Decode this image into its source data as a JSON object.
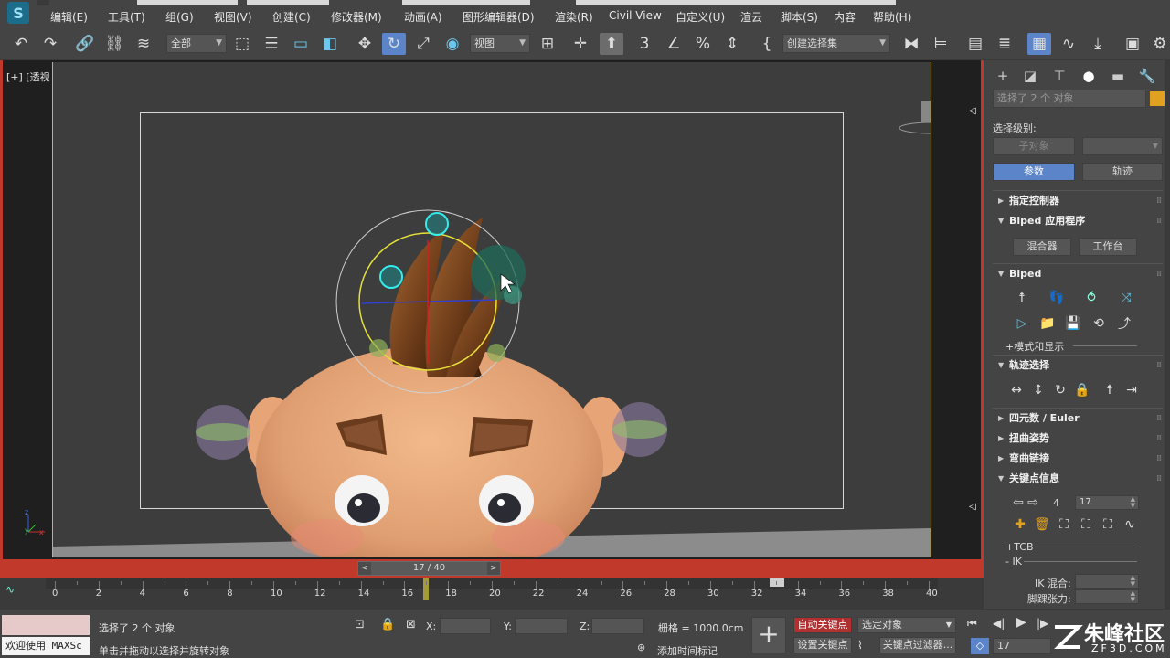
{
  "menu": {
    "items": [
      "编辑(E)",
      "工具(T)",
      "组(G)",
      "视图(V)",
      "创建(C)",
      "修改器(M)",
      "动画(A)",
      "图形编辑器(D)",
      "渲染(R)",
      "Civil View",
      "自定义(U)",
      "渲云",
      "脚本(S)",
      "内容",
      "帮助(H)"
    ]
  },
  "toolbar": {
    "filter_dropdown": "全部",
    "refcoord_dropdown": "视图",
    "selection_set_dropdown": "创建选择集"
  },
  "viewport": {
    "label": "[+] [透视 ] [用户定义 ] [默认明暗处理 ]",
    "axis_z": "z",
    "axis_x": "x",
    "axis_y": "y"
  },
  "timeslider": {
    "prev": "<",
    "next": ">",
    "current": "17 / 40"
  },
  "trackbar": {
    "labels": [
      "0",
      "2",
      "4",
      "6",
      "8",
      "10",
      "12",
      "14",
      "16",
      "18",
      "20",
      "22",
      "24",
      "26",
      "28",
      "30",
      "32",
      "34",
      "36",
      "38",
      "40"
    ]
  },
  "status": {
    "mini_listener_label": "欢迎使用 MAXSc",
    "selection_text": "选择了 2 个 对象",
    "prompt_text": "单击并拖动以选择并旋转对象",
    "x_label": "X:",
    "y_label": "Y:",
    "z_label": "Z:",
    "grid_text": "栅格 = 1000.0cm",
    "add_time_tag": "添加时间标记",
    "auto_key": "自动关键点",
    "set_key": "设置关键点",
    "selected_dropdown": "选定对象",
    "key_filters": "关键点过滤器...",
    "frame_field": "17"
  },
  "cmdpanel": {
    "name_field": "选择了 2 个 对象",
    "selection_level_label": "选择级别:",
    "sub_object_btn": "子对象",
    "params_btn": "参数",
    "track_btn": "轨迹",
    "rollouts": {
      "assign_controller": "指定控制器",
      "biped_apps": "Biped 应用程序",
      "biped": "Biped",
      "track_selection": "轨迹选择",
      "quaternion_euler": "四元数 / Euler",
      "twist_poses": "扭曲姿势",
      "bend_links": "弯曲链接",
      "key_info": "关键点信息"
    },
    "mixer_btn": "混合器",
    "workbench_btn": "工作台",
    "mode_display": "+模式和显示",
    "key_number": "4",
    "key_frame": "17",
    "tcb": "+TCB",
    "ik": "- IK",
    "ik_blend_label": "IK 混合:",
    "ankle_tension_label": "脚踝张力:"
  },
  "watermark": {
    "text": "朱峰社区",
    "url": "ZF3D.COM"
  },
  "colors": {
    "accent_blue": "#5b84c9",
    "viewport_border_red": "#c0392b",
    "auto_key_red": "#b03030"
  }
}
